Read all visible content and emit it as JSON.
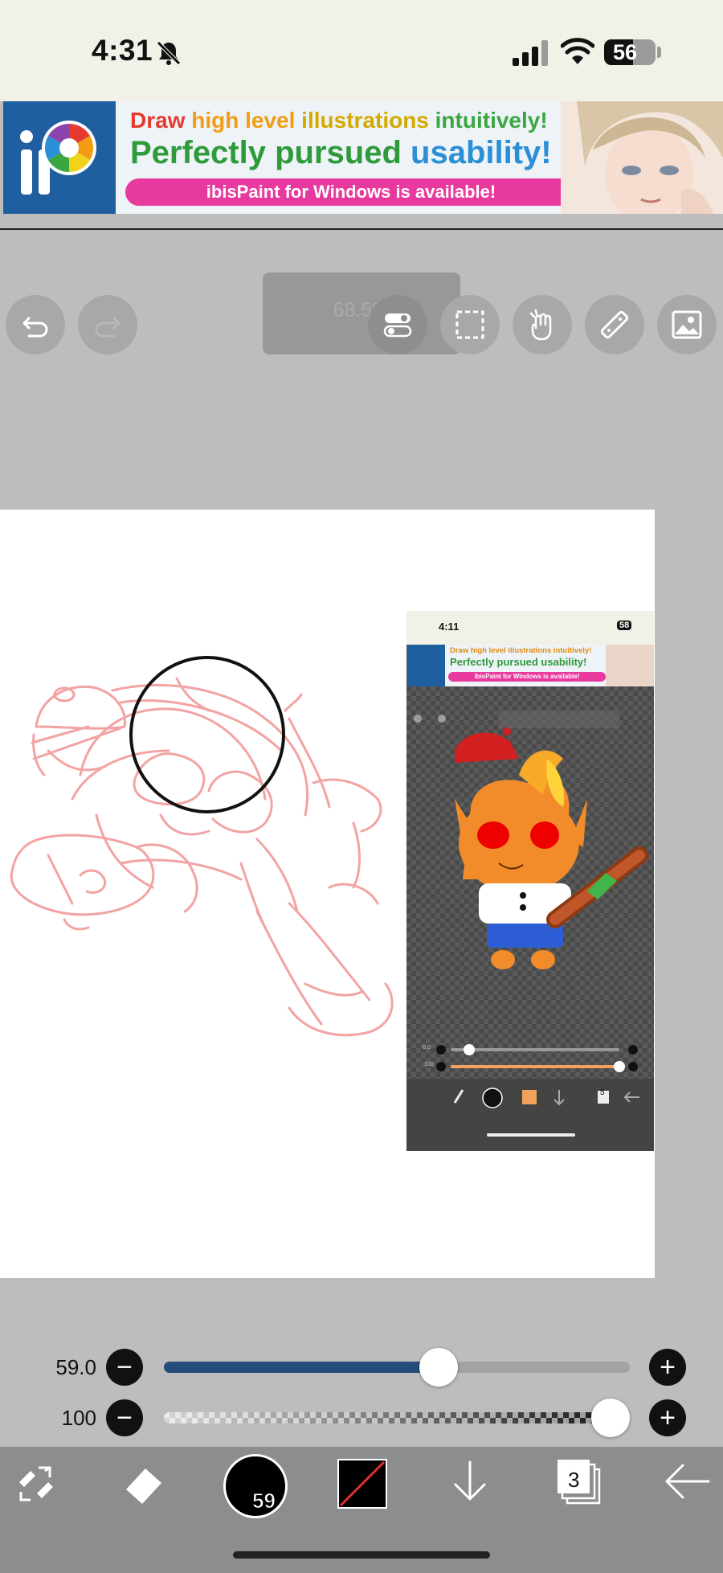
{
  "status_bar": {
    "time": "4:31",
    "battery": "56",
    "battery_level": 0.56,
    "icons": [
      "bell-slash-icon",
      "cellular-signal-icon",
      "wifi-icon",
      "battery-icon"
    ]
  },
  "ad_banner": {
    "line1_parts": [
      "Draw",
      " high level",
      " illustrations",
      " intuitively!"
    ],
    "line2_parts": [
      "Perfectly pursued ",
      "usability!"
    ],
    "pill_text": "ibisPaint for Windows is available!",
    "colors": {
      "draw": "#e53a2f",
      "high_level": "#f39c12",
      "illustrations": "#e0b400",
      "intuitively": "#3aa640",
      "perfectly": "#2e9a3a",
      "usability": "#2a8fd6",
      "pill": "#e83a9e"
    }
  },
  "top_toolbar": {
    "zoom_label": "68.5%",
    "buttons": [
      "undo-icon",
      "redo-icon",
      "layer-toggle-icon",
      "selection-icon",
      "hand-icon",
      "ruler-icon",
      "image-icon"
    ]
  },
  "canvas": {
    "embedded_screenshot": {
      "time": "4:11",
      "battery": "58",
      "ad_line1": "Draw high level illustrations intuitively!",
      "ad_line2": "Perfectly pursued usability!",
      "ad_pill": "ibisPaint for Windows is available!",
      "slider1_value": "0.0",
      "slider2_value": "100",
      "layers_count": "5"
    }
  },
  "brush_controls": {
    "size_value": "59.0",
    "size_fraction": 0.59,
    "opacity_value": "100",
    "opacity_fraction": 1.0,
    "minus_symbol": "−",
    "plus_symbol": "+",
    "size_track_color": "#244d79"
  },
  "bottom_toolbar": {
    "brush_size_badge": "59",
    "layers_count": "3",
    "items": [
      "transform-tool-icon",
      "eraser-icon",
      "brush-preview",
      "color-swatch",
      "move-down-icon",
      "layers-icon",
      "back-arrow-icon"
    ]
  }
}
